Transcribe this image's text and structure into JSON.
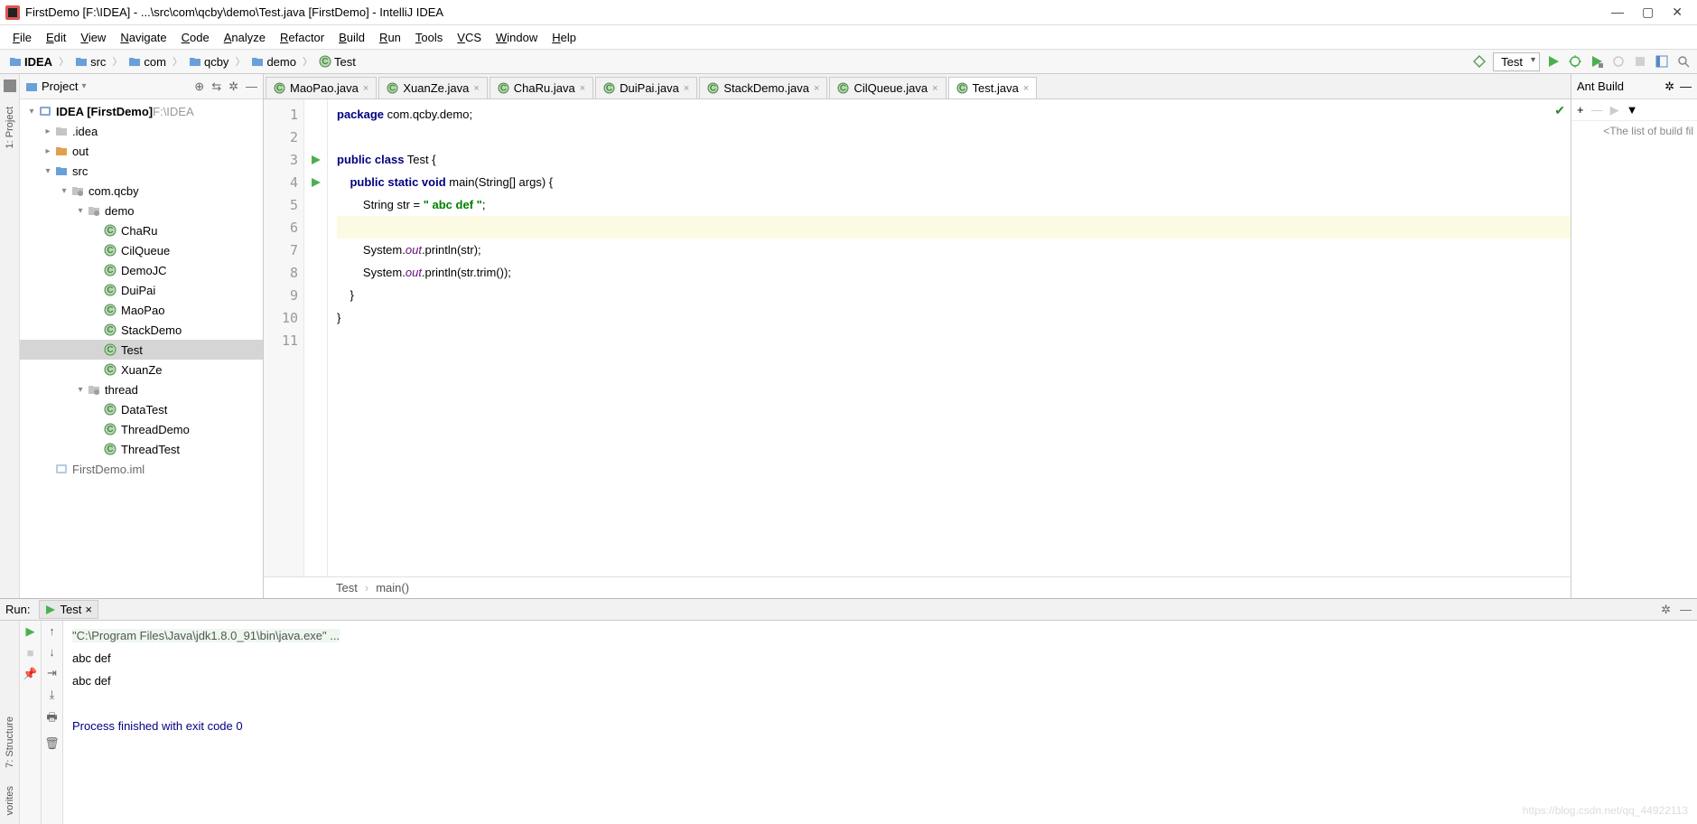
{
  "titlebar": {
    "text": "FirstDemo [F:\\IDEA] - ...\\src\\com\\qcby\\demo\\Test.java [FirstDemo] - IntelliJ IDEA"
  },
  "menus": [
    "File",
    "Edit",
    "View",
    "Navigate",
    "Code",
    "Analyze",
    "Refactor",
    "Build",
    "Run",
    "Tools",
    "VCS",
    "Window",
    "Help"
  ],
  "breadcrumbs": [
    {
      "label": "IDEA",
      "icon": "folder",
      "bold": true
    },
    {
      "label": "src",
      "icon": "folder"
    },
    {
      "label": "com",
      "icon": "folder"
    },
    {
      "label": "qcby",
      "icon": "folder"
    },
    {
      "label": "demo",
      "icon": "folder"
    },
    {
      "label": "Test",
      "icon": "class"
    }
  ],
  "run_config": "Test",
  "project_panel": {
    "title": "Project"
  },
  "tree": [
    {
      "depth": 0,
      "arrow": "▾",
      "icon": "module",
      "label": "IDEA [FirstDemo]",
      "suffix": "F:\\IDEA"
    },
    {
      "depth": 1,
      "arrow": "▸",
      "icon": "folder-gray",
      "label": ".idea"
    },
    {
      "depth": 1,
      "arrow": "▸",
      "icon": "folder-orange",
      "label": "out"
    },
    {
      "depth": 1,
      "arrow": "▾",
      "icon": "folder-blue",
      "label": "src"
    },
    {
      "depth": 2,
      "arrow": "▾",
      "icon": "package",
      "label": "com.qcby"
    },
    {
      "depth": 3,
      "arrow": "▾",
      "icon": "package",
      "label": "demo"
    },
    {
      "depth": 4,
      "arrow": "",
      "icon": "class",
      "label": "ChaRu"
    },
    {
      "depth": 4,
      "arrow": "",
      "icon": "class",
      "label": "CilQueue"
    },
    {
      "depth": 4,
      "arrow": "",
      "icon": "class",
      "label": "DemoJC"
    },
    {
      "depth": 4,
      "arrow": "",
      "icon": "class",
      "label": "DuiPai"
    },
    {
      "depth": 4,
      "arrow": "",
      "icon": "class",
      "label": "MaoPao"
    },
    {
      "depth": 4,
      "arrow": "",
      "icon": "class",
      "label": "StackDemo"
    },
    {
      "depth": 4,
      "arrow": "",
      "icon": "class",
      "label": "Test",
      "selected": true
    },
    {
      "depth": 4,
      "arrow": "",
      "icon": "class",
      "label": "XuanZe"
    },
    {
      "depth": 3,
      "arrow": "▾",
      "icon": "package",
      "label": "thread"
    },
    {
      "depth": 4,
      "arrow": "",
      "icon": "class",
      "label": "DataTest"
    },
    {
      "depth": 4,
      "arrow": "",
      "icon": "class",
      "label": "ThreadDemo"
    },
    {
      "depth": 4,
      "arrow": "",
      "icon": "class",
      "label": "ThreadTest"
    },
    {
      "depth": 1,
      "arrow": "",
      "icon": "module",
      "label": "FirstDemo.iml",
      "cut": true
    }
  ],
  "tabs": [
    {
      "label": "MaoPao.java"
    },
    {
      "label": "XuanZe.java"
    },
    {
      "label": "ChaRu.java"
    },
    {
      "label": "DuiPai.java"
    },
    {
      "label": "StackDemo.java"
    },
    {
      "label": "CilQueue.java"
    },
    {
      "label": "Test.java",
      "active": true
    }
  ],
  "code": {
    "lines": [
      {
        "n": 1,
        "html": "<span class='kw'>package</span> com.qcby.demo;"
      },
      {
        "n": 2,
        "html": ""
      },
      {
        "n": 3,
        "html": "<span class='kw'>public class</span> Test {",
        "run": true
      },
      {
        "n": 4,
        "html": "    <span class='kw'>public static void</span> main(String[] args) {",
        "run": true
      },
      {
        "n": 5,
        "html": "        String str = <span class='str'>\" abc def \"</span>;"
      },
      {
        "n": 6,
        "html": "",
        "hl": true
      },
      {
        "n": 7,
        "html": "        System.<span class='fld'>out</span>.println(str);"
      },
      {
        "n": 8,
        "html": "        System.<span class='fld'>out</span>.println(str.trim());"
      },
      {
        "n": 9,
        "html": "    }"
      },
      {
        "n": 10,
        "html": "}"
      },
      {
        "n": 11,
        "html": ""
      }
    ]
  },
  "editor_breadcrumb": [
    "Test",
    "main()"
  ],
  "ant": {
    "title": "Ant Build",
    "empty": "<The list of build fil"
  },
  "run": {
    "label": "Run:",
    "tab": "Test",
    "lines": [
      {
        "type": "cmd",
        "text": "\"C:\\Program Files\\Java\\jdk1.8.0_91\\bin\\java.exe\" ..."
      },
      {
        "type": "out",
        "text": " abc def "
      },
      {
        "type": "out",
        "text": "abc def"
      },
      {
        "type": "blank",
        "text": ""
      },
      {
        "type": "exit",
        "text": "Process finished with exit code 0"
      }
    ]
  },
  "left_tabs": {
    "project": "1: Project",
    "structure": "7: Structure",
    "favorites": "vorites"
  },
  "watermark": "https://blog.csdn.net/qq_44922113"
}
